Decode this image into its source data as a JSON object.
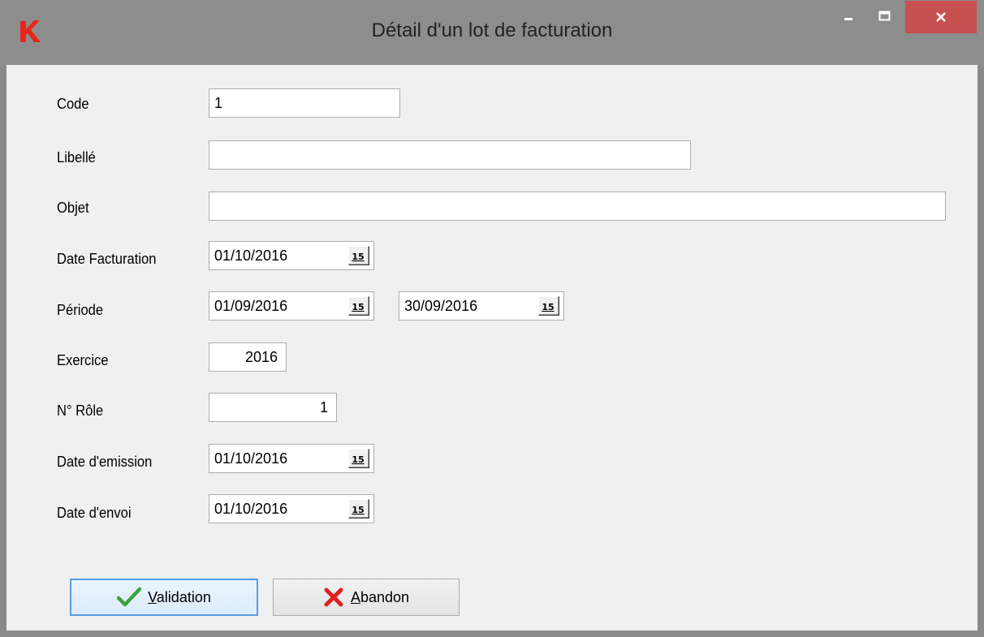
{
  "window": {
    "title": "Détail d'un lot de facturation",
    "close_glyph": "✕",
    "minimize_glyph": "–",
    "maximize_glyph": "☐"
  },
  "colors": {
    "close_button": "#c75050",
    "logo": "#e8261d",
    "default_button_border": "#569de5",
    "check_icon": "#3aa53a",
    "cancel_icon": "#e02020"
  },
  "form": {
    "code": {
      "label": "Code",
      "value": "1"
    },
    "libelle": {
      "label": "Libellé",
      "value": ""
    },
    "objet": {
      "label": "Objet",
      "value": ""
    },
    "date_facturation": {
      "label": "Date Facturation",
      "value": "01/10/2016"
    },
    "periode": {
      "label": "Période",
      "start": "01/09/2016",
      "end": "30/09/2016"
    },
    "exercice": {
      "label": "Exercice",
      "value": "2016"
    },
    "num_role": {
      "label": "N° Rôle",
      "value": "1"
    },
    "date_emission": {
      "label": "Date d'emission",
      "value": "01/10/2016"
    },
    "date_envoi": {
      "label": "Date d'envoi",
      "value": "01/10/2016"
    },
    "calendar_icon_text": "15"
  },
  "buttons": {
    "validation": {
      "mnemonic": "V",
      "rest": "alidation",
      "icon": "check-icon"
    },
    "abandon": {
      "mnemonic": "A",
      "rest": "bandon",
      "icon": "cancel-icon"
    }
  }
}
